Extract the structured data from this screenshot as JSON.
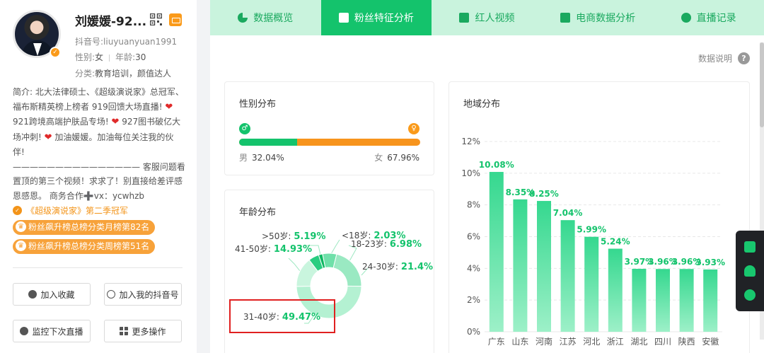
{
  "profile": {
    "name": "刘媛媛-92...",
    "douyin_id": "抖音号:liuyuanyuan1991",
    "gender_label": "性别:",
    "gender": "女",
    "age_label": "年龄:",
    "age": "30",
    "category_label": "分类:",
    "category": "教育培训，颜值达人",
    "bio_1": "简介: 北大法律硕士、《超级演说家》总冠军、福布斯精英榜上榜者 919回馈大场直播!",
    "bio_2": " 921跨境高端护肤品专场!",
    "bio_3": " 927图书破亿大场冲刺!",
    "bio_4": " 加油媛媛。加油每位关注我的伙伴!",
    "bio_5": "——————————————— 客服问题看置顶的第三个视频！求求了！别直接给差评感恩感恩。 商务合作➕vx：ycwhzb",
    "award": "《超级演说家》第二季冠军",
    "rank_1": "粉丝飙升榜总榜分类月榜第82名",
    "rank_2": "粉丝飙升榜总榜分类周榜第51名"
  },
  "actions": {
    "collect": "加入收藏",
    "add_account": "加入我的抖音号",
    "monitor": "监控下次直播",
    "more": "更多操作"
  },
  "tabs": [
    {
      "label": "数据概览",
      "icon": "pie-chart-icon"
    },
    {
      "label": "粉丝特征分析",
      "icon": "id-card-icon"
    },
    {
      "label": "红人视频",
      "icon": "video-icon"
    },
    {
      "label": "电商数据分析",
      "icon": "shop-icon"
    },
    {
      "label": "直播记录",
      "icon": "clock-icon"
    }
  ],
  "data_note": "数据说明",
  "gender_card": {
    "title": "性别分布",
    "male_label": "男",
    "male_value": "32.04%",
    "female_label": "女",
    "female_value": "67.96%",
    "male_share": 32.04
  },
  "age_card": {
    "title": "年龄分布",
    "items": [
      {
        "label": ">50岁:",
        "value": "5.19%",
        "pct": 5.19
      },
      {
        "label": "<18岁:",
        "value": "2.03%",
        "pct": 2.03
      },
      {
        "label": "41-50岁:",
        "value": "14.93%",
        "pct": 14.93
      },
      {
        "label": "18-23岁:",
        "value": "6.98%",
        "pct": 6.98
      },
      {
        "label": "24-30岁:",
        "value": "21.4%",
        "pct": 21.4
      },
      {
        "label": "31-40岁:",
        "value": "49.47%",
        "pct": 49.47
      }
    ]
  },
  "region_card": {
    "title": "地域分布"
  },
  "chart_data": {
    "type": "bar",
    "categories": [
      "广东",
      "山东",
      "河南",
      "江苏",
      "河北",
      "浙江",
      "湖北",
      "四川",
      "陕西",
      "安徽"
    ],
    "values": [
      10.08,
      8.35,
      8.25,
      7.04,
      5.99,
      5.24,
      3.97,
      3.96,
      3.96,
      3.93
    ],
    "value_labels": [
      "10.08%",
      "8.35%",
      "8.25%",
      "7.04%",
      "5.99%",
      "5.24%",
      "3.97%",
      "3.96%",
      "3.96%",
      "3.93%"
    ],
    "yticks": [
      "0%",
      "2%",
      "4%",
      "6%",
      "8%",
      "10%",
      "12%"
    ],
    "ylim": [
      0,
      12
    ],
    "title": "地域分布",
    "colors": [
      "#9df0c8",
      "#35d88f"
    ]
  }
}
